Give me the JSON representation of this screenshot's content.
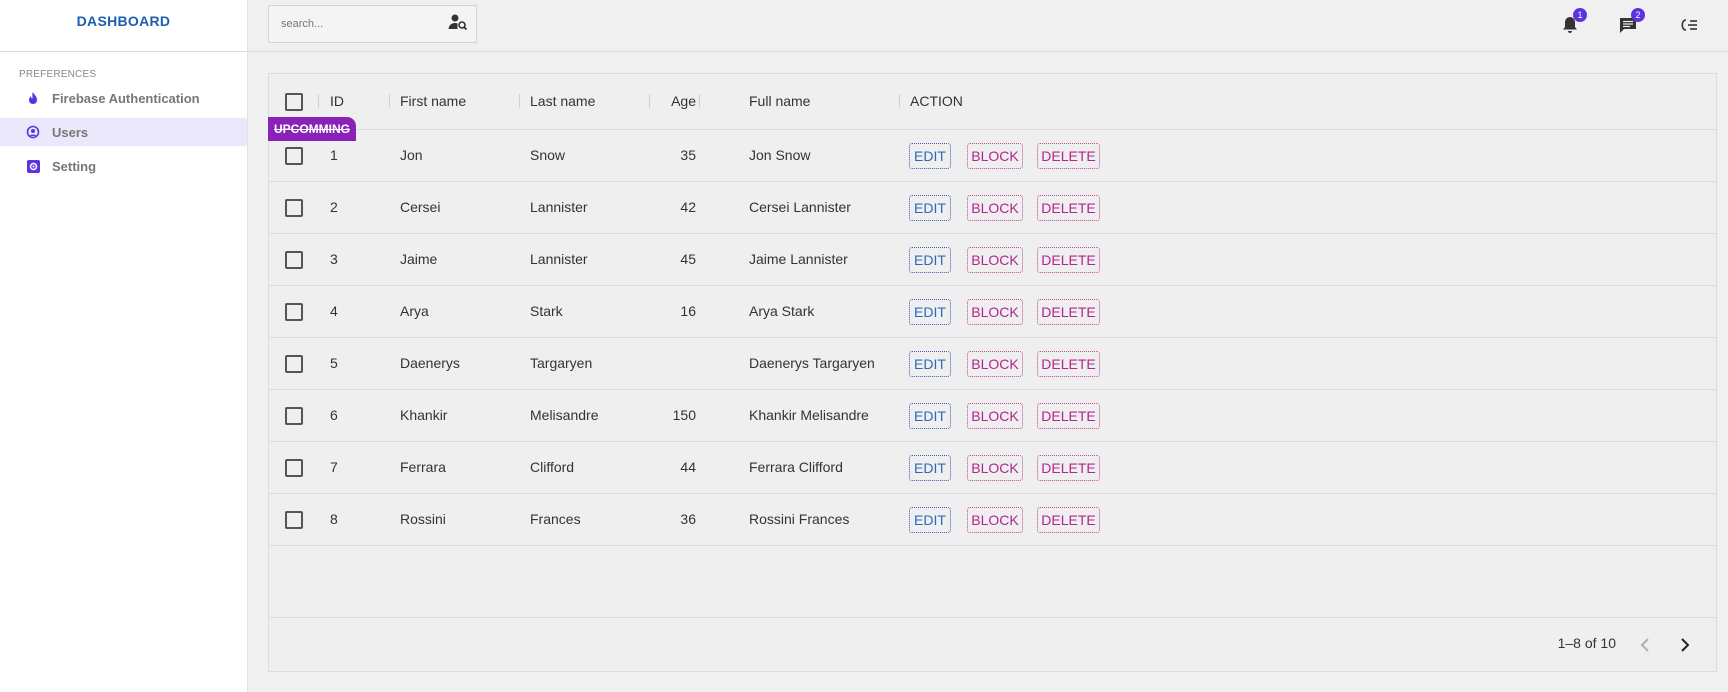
{
  "sidebar": {
    "logo": "DASHBOARD",
    "section_title": "PREFERENCES",
    "items": [
      {
        "label": "Firebase Authentication",
        "icon": "fire-icon"
      },
      {
        "label": "Users",
        "icon": "headset-user-icon",
        "active": true
      },
      {
        "label": "Setting",
        "icon": "settings-icon"
      }
    ]
  },
  "topbar": {
    "search_placeholder": "search...",
    "notifications_count": "1",
    "messages_count": "2"
  },
  "colors": {
    "accent": "#5b34e0",
    "brand": "#1b5eb0",
    "tag": "#8a22b8",
    "edit": "#2a6bbd",
    "danger": "#b3258f"
  },
  "grid": {
    "columns": [
      "ID",
      "First name",
      "Last name",
      "Age",
      "Full name",
      "ACTION"
    ],
    "tag_label": "UPCOMMING",
    "actions": {
      "edit": "EDIT",
      "block": "BLOCK",
      "delete": "DELETE"
    },
    "rows": [
      {
        "id": "1",
        "first": "Jon",
        "last": "Snow",
        "age": "35",
        "full": "Jon Snow"
      },
      {
        "id": "2",
        "first": "Cersei",
        "last": "Lannister",
        "age": "42",
        "full": "Cersei Lannister"
      },
      {
        "id": "3",
        "first": "Jaime",
        "last": "Lannister",
        "age": "45",
        "full": "Jaime Lannister"
      },
      {
        "id": "4",
        "first": "Arya",
        "last": "Stark",
        "age": "16",
        "full": "Arya Stark"
      },
      {
        "id": "5",
        "first": "Daenerys",
        "last": "Targaryen",
        "age": "",
        "full": "Daenerys Targaryen"
      },
      {
        "id": "6",
        "first": "Khankir",
        "last": "Melisandre",
        "age": "150",
        "full": "Khankir Melisandre"
      },
      {
        "id": "7",
        "first": "Ferrara",
        "last": "Clifford",
        "age": "44",
        "full": "Ferrara Clifford"
      },
      {
        "id": "8",
        "first": "Rossini",
        "last": "Frances",
        "age": "36",
        "full": "Rossini Frances"
      }
    ],
    "pagination": "1–8 of 10"
  }
}
